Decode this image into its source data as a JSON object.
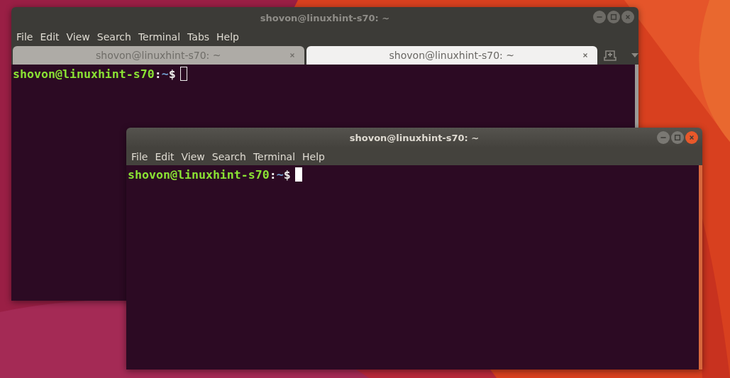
{
  "windows": [
    {
      "title": "shovon@linuxhint-s70: ~",
      "focused": false,
      "menu": [
        "File",
        "Edit",
        "View",
        "Search",
        "Terminal",
        "Tabs",
        "Help"
      ],
      "tabs": [
        {
          "label": "shovon@linuxhint-s70: ~",
          "selected": false
        },
        {
          "label": "shovon@linuxhint-s70: ~",
          "selected": true
        }
      ],
      "prompt": {
        "user_host": "shovon@linuxhint-s70",
        "separator": ":",
        "path": "~",
        "symbol": "$"
      }
    },
    {
      "title": "shovon@linuxhint-s70: ~",
      "focused": true,
      "menu": [
        "File",
        "Edit",
        "View",
        "Search",
        "Terminal",
        "Help"
      ],
      "prompt": {
        "user_host": "shovon@linuxhint-s70",
        "separator": ":",
        "path": "~",
        "symbol": "$"
      }
    }
  ]
}
